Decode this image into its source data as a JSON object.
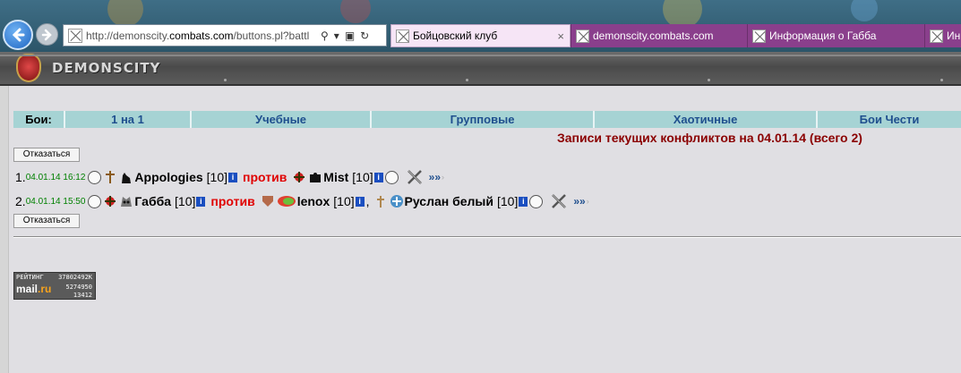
{
  "browser": {
    "url_prefix": "http://demonscity.",
    "url_domain": "combats.com",
    "url_suffix": "/buttons.pl?battl",
    "tabs": [
      {
        "label": "Бойцовский клуб",
        "active": true
      },
      {
        "label": "demonscity.combats.com",
        "active": false
      },
      {
        "label": "Информация о Габба",
        "active": false
      },
      {
        "label": "Ин",
        "active": false
      }
    ],
    "close_glyph": "×"
  },
  "site": {
    "logo_text": "DEMONSCITY"
  },
  "fight_bar": {
    "label": "Бои:",
    "tabs": [
      "1 на 1",
      "Учебные",
      "Групповые",
      "Хаотичные",
      "Бои Чести"
    ]
  },
  "buttons": {
    "refuse_1": "Отказаться",
    "refuse_2": "Отказаться"
  },
  "records_title": "Записи текущих конфликтов на 04.01.14 (всего 2)",
  "fights": [
    {
      "num": "1.",
      "time": "04.01.14 16:12",
      "side_a": [
        {
          "name": "Appologies",
          "level": "[10]"
        }
      ],
      "vs": "против",
      "side_b": [
        {
          "name": "Mist",
          "level": "[10]"
        }
      ],
      "more": "»»"
    },
    {
      "num": "2.",
      "time": "04.01.14 15:50",
      "side_a": [
        {
          "name": "Габба",
          "level": "[10]"
        }
      ],
      "vs": "против",
      "side_b": [
        {
          "name": "lenox",
          "level": "[10]"
        },
        {
          "name": "Руслан белый",
          "level": "[10]"
        }
      ],
      "separator": ",",
      "more": "»»"
    }
  ],
  "info_glyph": "i",
  "counter": {
    "title": "РЕЙТИНГ",
    "logo_main": "mail",
    "logo_dot": ".ru",
    "value_1": "3780",
    "value_1b": "2492K",
    "value_2": "5274950",
    "value_3": "13412"
  },
  "colors": {
    "fight_bar_bg": "#a6d3d4",
    "fight_tab_text": "#1f4f8e",
    "records_title": "#8b0000",
    "vs_text": "#e00000",
    "time_text": "#008000",
    "active_tab_bg": "#f6e5f6",
    "inactive_tab_bg": "#8a3f8c"
  }
}
